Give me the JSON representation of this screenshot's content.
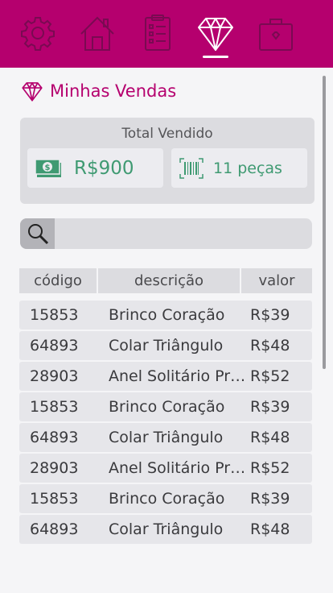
{
  "colors": {
    "brand": "#b5006e",
    "money_green": "#3f9a72",
    "nav_icon": "#7a0a52"
  },
  "nav": {
    "items": [
      {
        "icon": "gear-icon",
        "active": false
      },
      {
        "icon": "house-icon",
        "active": false
      },
      {
        "icon": "clipboard-icon",
        "active": false
      },
      {
        "icon": "diamond-icon",
        "active": true
      },
      {
        "icon": "briefcase-icon",
        "active": false
      }
    ]
  },
  "page": {
    "title": "Minhas Vendas",
    "title_icon": "diamond-icon"
  },
  "summary": {
    "title": "Total Vendido",
    "total_value": "R$900",
    "total_icon": "cash-icon",
    "pieces_value": "11 peças",
    "pieces_icon": "barcode-icon"
  },
  "search": {
    "placeholder": "",
    "value": "",
    "icon": "search-icon"
  },
  "table": {
    "headers": [
      "código",
      "descrição",
      "valor"
    ],
    "rows": [
      [
        "15853",
        "Brinco Coração",
        "R$39"
      ],
      [
        "64893",
        "Colar Triângulo",
        "R$48"
      ],
      [
        "28903",
        "Anel Solitário Prata",
        "R$52"
      ],
      [
        "15853",
        "Brinco Coração",
        "R$39"
      ],
      [
        "64893",
        "Colar Triângulo",
        "R$48"
      ],
      [
        "28903",
        "Anel Solitário Prata",
        "R$52"
      ],
      [
        "15853",
        "Brinco Coração",
        "R$39"
      ],
      [
        "64893",
        "Colar Triângulo",
        "R$48"
      ]
    ]
  }
}
